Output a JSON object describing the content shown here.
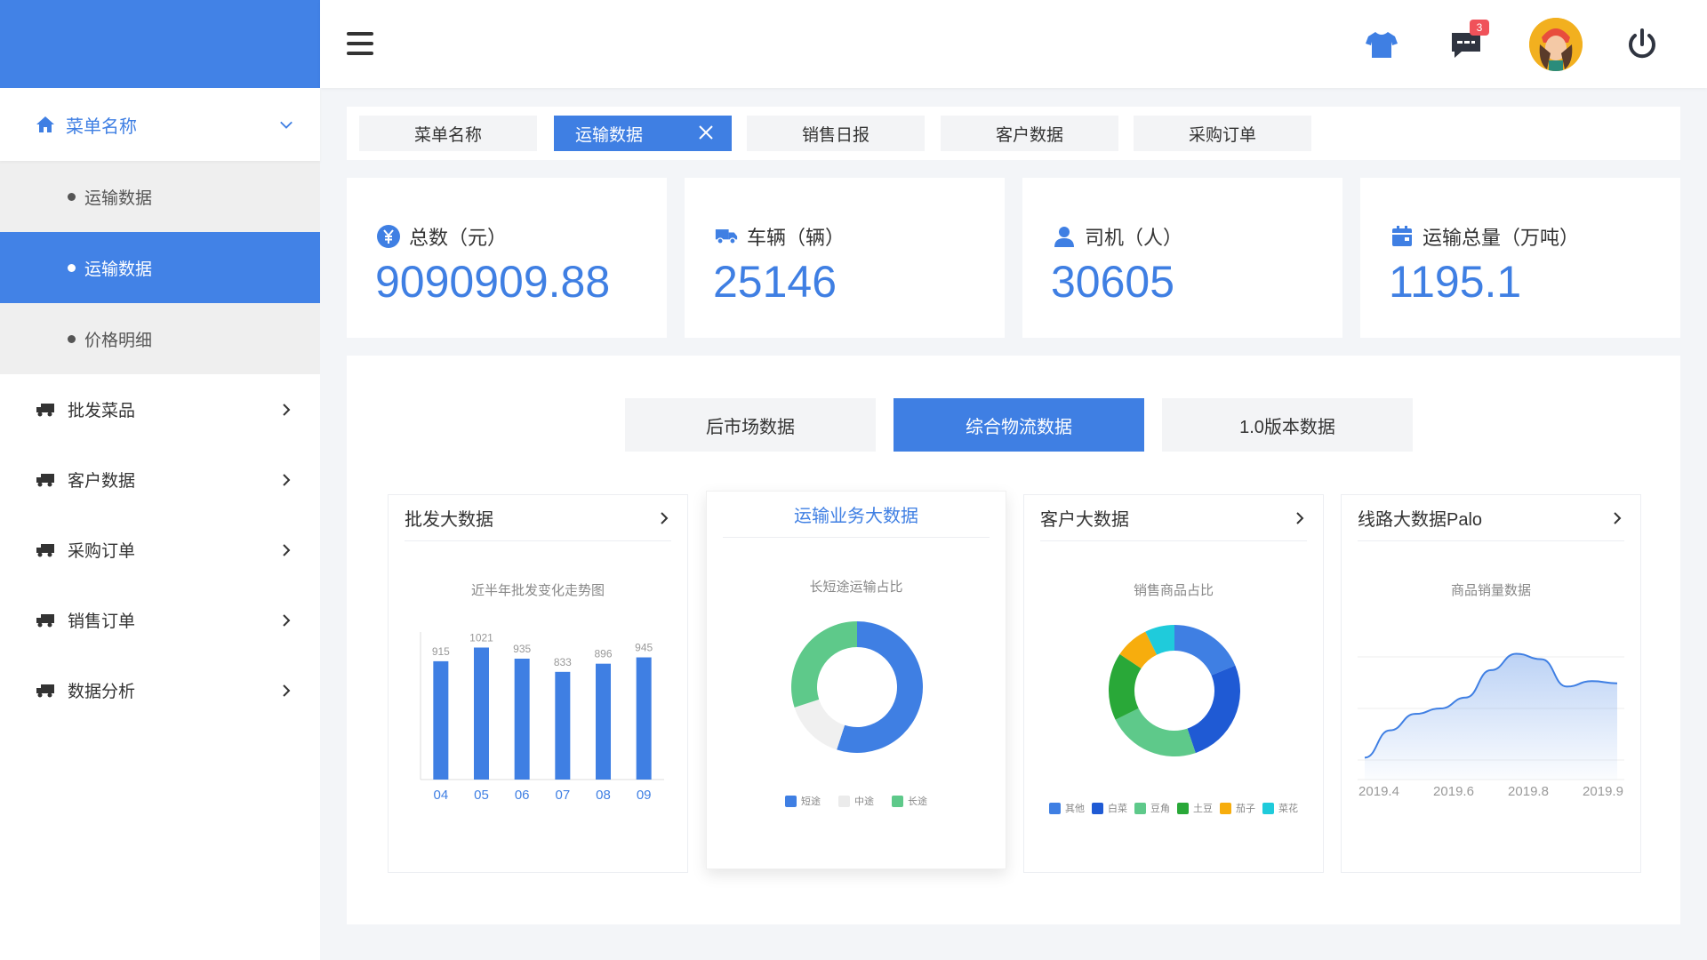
{
  "sidebar": {
    "menu_head": {
      "label": "菜单名称"
    },
    "sub_items": [
      {
        "label": "运输数据",
        "active": false
      },
      {
        "label": "运输数据",
        "active": true
      },
      {
        "label": "价格明细",
        "active": false
      }
    ],
    "items": [
      {
        "label": "批发菜品"
      },
      {
        "label": "客户数据"
      },
      {
        "label": "采购订单"
      },
      {
        "label": "销售订单"
      },
      {
        "label": "数据分析"
      }
    ]
  },
  "topbar": {
    "icons": [
      "shirt-icon",
      "message-icon",
      "avatar",
      "power-icon"
    ],
    "message_badge": "3"
  },
  "tabs": [
    {
      "label": "菜单名称",
      "active": false
    },
    {
      "label": "运输数据",
      "active": true,
      "closable": true
    },
    {
      "label": "销售日报",
      "active": false
    },
    {
      "label": "客户数据",
      "active": false
    },
    {
      "label": "采购订单",
      "active": false
    }
  ],
  "stats": [
    {
      "label": "总数（元）",
      "value": "9090909.88",
      "icon": "yuan-icon"
    },
    {
      "label": "车辆（辆）",
      "value": "25146",
      "icon": "truck-icon"
    },
    {
      "label": "司机（人）",
      "value": "30605",
      "icon": "person-icon"
    },
    {
      "label": "运输总量（万吨）",
      "value": "1195.1",
      "icon": "box-icon"
    }
  ],
  "segments": [
    {
      "label": "后市场数据",
      "active": false
    },
    {
      "label": "综合物流数据",
      "active": true
    },
    {
      "label": "1.0版本数据",
      "active": false
    }
  ],
  "colors": {
    "accent": "#3f7fe3",
    "brand": "#4282e6"
  },
  "chart_data": [
    {
      "type": "bar",
      "card_title": "批发大数据",
      "title": "近半年批发变化走势图",
      "categories": [
        "04",
        "05",
        "06",
        "07",
        "08",
        "09"
      ],
      "values": [
        915,
        1021,
        935,
        833,
        896,
        945
      ],
      "ylim": [
        0,
        1100
      ],
      "color": "#3f7fe3"
    },
    {
      "type": "pie",
      "card_title": "运输业务大数据",
      "title": "长短途运输占比",
      "donut": true,
      "labels": [
        "短途",
        "中途",
        "长途"
      ],
      "values": [
        55,
        15,
        30
      ],
      "colors": [
        "#3f7fe3",
        "#f0f0f0",
        "#5ec98a"
      ]
    },
    {
      "type": "pie",
      "card_title": "客户大数据",
      "title": "销售商品占比",
      "donut": true,
      "labels": [
        "其他",
        "白菜",
        "豆角",
        "土豆",
        "茄子",
        "菜花"
      ],
      "values": [
        18,
        25,
        22,
        16,
        8,
        7
      ],
      "colors": [
        "#3f7fe3",
        "#1f5ad4",
        "#5ec98a",
        "#29a838",
        "#f7ad0d",
        "#1fcbdb"
      ]
    },
    {
      "type": "area",
      "card_title": "线路大数据Palo",
      "title": "商品销量数据",
      "categories": [
        "2019.4",
        "2019.6",
        "2019.8",
        "2019.9"
      ],
      "x": [
        0,
        1,
        2,
        3,
        4,
        5,
        6,
        7,
        8,
        9,
        10
      ],
      "values": [
        20,
        45,
        60,
        65,
        75,
        100,
        115,
        110,
        85,
        90,
        88
      ],
      "ylim": [
        0,
        130
      ],
      "color": "#3f7fe3"
    }
  ]
}
